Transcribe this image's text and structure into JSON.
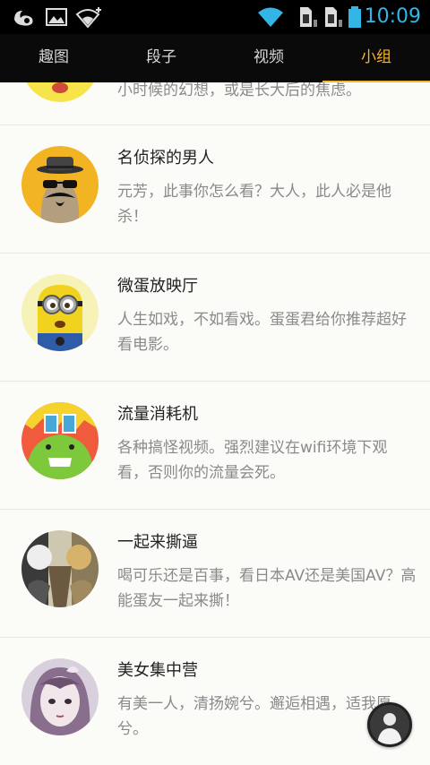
{
  "status_bar": {
    "time": "10:09",
    "icons": [
      "uc-browser-icon",
      "image-icon",
      "wifi-plus-icon",
      "wifi-signal-icon",
      "sim-1-icon",
      "sim-2-icon",
      "battery-icon"
    ],
    "time_color": "#33b5e5"
  },
  "tabs": [
    {
      "label": "趣图",
      "active": false
    },
    {
      "label": "段子",
      "active": false
    },
    {
      "label": "视频",
      "active": false
    },
    {
      "label": "小组",
      "active": true
    }
  ],
  "accent_color": "#f5b52c",
  "groups": [
    {
      "title": "",
      "desc": "小时候的幻想，或是长大后的焦虑。",
      "avatar": "yellow-face-avatar"
    },
    {
      "title": "名侦探的男人",
      "desc": "元芳，此事你怎么看？大人，此人必是他杀！",
      "avatar": "detective-mustache-avatar"
    },
    {
      "title": "微蛋放映厅",
      "desc": "人生如戏，不如看戏。蛋蛋君给你推荐超好看电影。",
      "avatar": "minion-avatar"
    },
    {
      "title": "流量消耗机",
      "desc": "各种搞怪视频。强烈建议在wifi环境下观看，否则你的流量会死。",
      "avatar": "green-monster-avatar"
    },
    {
      "title": "一起来撕逼",
      "desc": "喝可乐还是百事，看日本AV还是美国AV？高能蛋友一起来撕！",
      "avatar": "anime-fight-avatar"
    },
    {
      "title": "美女集中营",
      "desc": "有美一人，清扬婉兮。邂逅相遇，适我愿兮。",
      "avatar": "anime-girl-avatar"
    }
  ],
  "floating_button": {
    "icon": "user-avatar-icon"
  }
}
